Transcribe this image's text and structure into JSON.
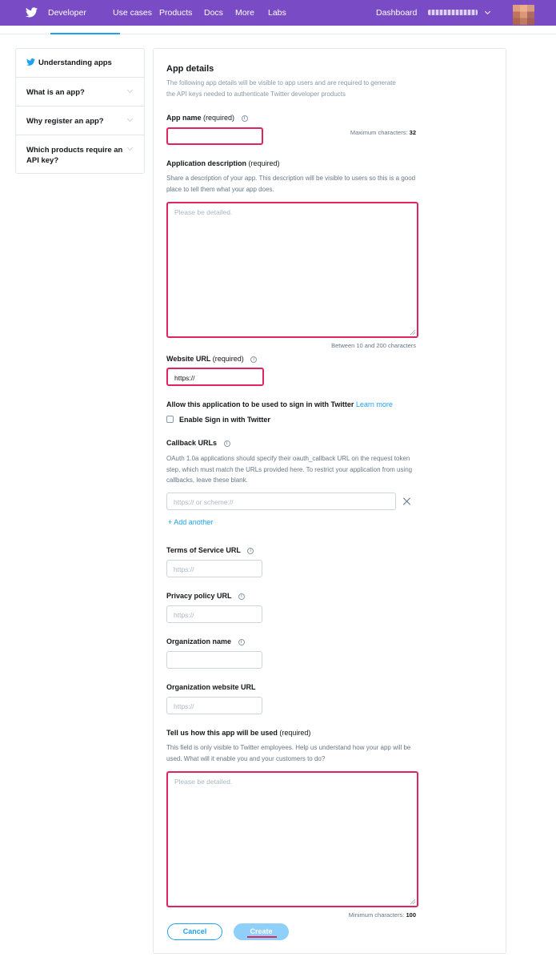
{
  "topnav": {
    "brand": "Developer",
    "links": [
      "Use cases",
      "Products",
      "Docs",
      "More",
      "Labs"
    ],
    "dashboard": "Dashboard",
    "colors": {
      "bg": "#794bc4",
      "accent": "#1da1f2"
    }
  },
  "sidebar": {
    "items": [
      {
        "label": "Understanding apps"
      },
      {
        "label": "What is an app?"
      },
      {
        "label": "Why register an app?"
      },
      {
        "label": "Which products require an API key?"
      }
    ]
  },
  "form": {
    "title": "App details",
    "intro": "The following app details will be visible to app users and are required to generate the API keys needed to authenticate Twitter developer products",
    "app_name": {
      "label": "App name",
      "req": "(required)",
      "hint_prefix": "Maximum characters: ",
      "hint_value": "32",
      "value": ""
    },
    "app_desc": {
      "label": "Application description",
      "req": "(required)",
      "help": "Share a description of your app. This description will be visible to users so this is a good place to tell them what your app does.",
      "placeholder": "Please be detailed.",
      "hint": "Between 10 and 200 characters"
    },
    "website": {
      "label": "Website URL",
      "req": "(required)",
      "value": "https://"
    },
    "signin": {
      "label": "Allow this application to be used to sign in with Twitter",
      "learn_more": "Learn more",
      "checkbox_label": "Enable Sign in with Twitter"
    },
    "callback": {
      "label": "Callback URLs",
      "help": "OAuth 1.0a applications should specify their oauth_callback URL on the request token step, which must match the URLs provided here. To restrict your application from using callbacks, leave these blank.",
      "placeholder": "https:// or scheme://",
      "add": "+ Add another"
    },
    "tos": {
      "label": "Terms of Service URL",
      "placeholder": "https://"
    },
    "privacy": {
      "label": "Privacy policy URL",
      "placeholder": "https://"
    },
    "org_name": {
      "label": "Organization name",
      "placeholder": ""
    },
    "org_site": {
      "label": "Organization website URL",
      "placeholder": "https://"
    },
    "usage": {
      "label": "Tell us how this app will be used",
      "req": "(required)",
      "help": "This field is only visible to Twitter employees. Help us understand how your app will be used. What will it enable you and your customers to do?",
      "placeholder": "Please be detailed.",
      "hint_prefix": "Minimum characters: ",
      "hint_value": "100"
    },
    "buttons": {
      "cancel": "Cancel",
      "create": "Create"
    },
    "colors": {
      "error": "#e0245e"
    }
  }
}
